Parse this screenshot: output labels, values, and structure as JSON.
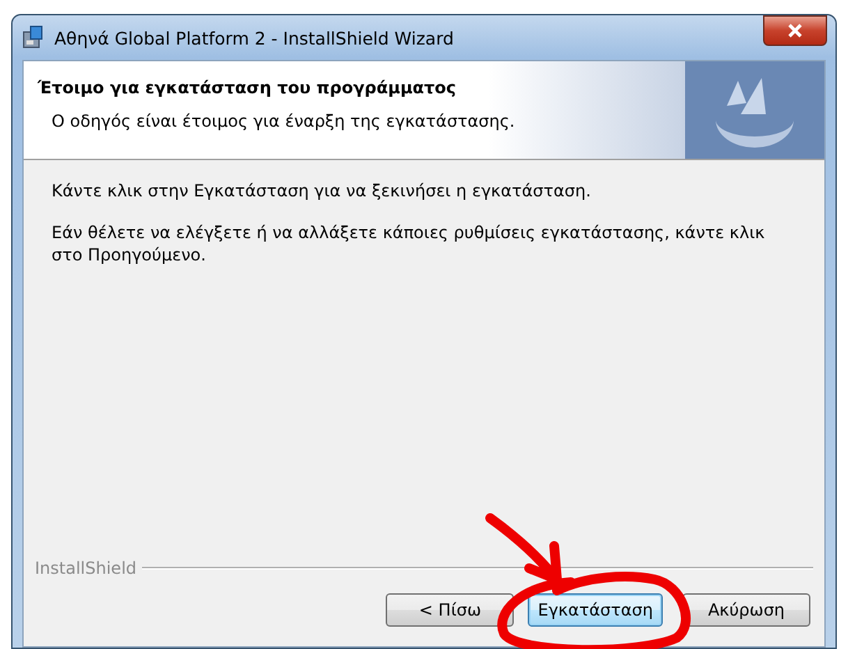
{
  "window": {
    "title": "Αθηνά Global Platform 2 - InstallShield Wizard"
  },
  "header": {
    "title": "Έτοιμο για εγκατάσταση του προγράμματος",
    "subtitle": "Ο οδηγός είναι έτοιμος για έναρξη της εγκατάστασης."
  },
  "body": {
    "paragraphs": [
      "Κάντε κλικ στην Εγκατάσταση για να ξεκινήσει η εγκατάσταση.",
      "Εάν θέλετε να ελέγξετε ή να αλλάξετε κάποιες ρυθμίσεις εγκατάστασης, κάντε κλικ στο Προηγούμενο."
    ]
  },
  "brand": "InstallShield",
  "buttons": [
    {
      "label": "< Πίσω",
      "default": false
    },
    {
      "label": "Εγκατάσταση",
      "default": true
    },
    {
      "label": "Ακύρωση",
      "default": false
    }
  ]
}
